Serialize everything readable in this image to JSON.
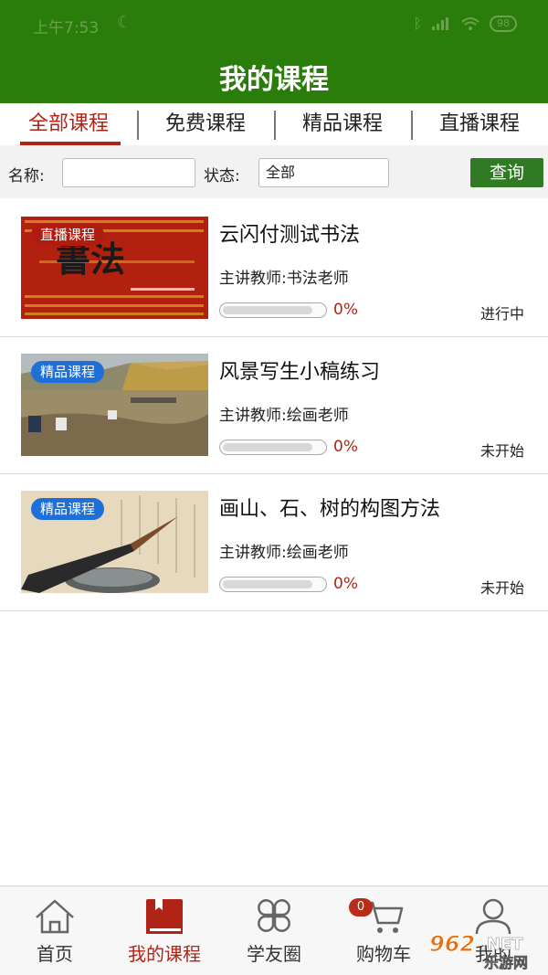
{
  "status_bar": {
    "time": "上午7:53",
    "battery": "98"
  },
  "header": {
    "title": "我的课程"
  },
  "tabs": [
    {
      "label": "全部课程",
      "active": true
    },
    {
      "label": "免费课程",
      "active": false
    },
    {
      "label": "精品课程",
      "active": false
    },
    {
      "label": "直播课程",
      "active": false
    }
  ],
  "filter": {
    "name_label": "名称:",
    "name_value": "",
    "status_label": "状态:",
    "status_value": "全部",
    "query_button": "查询"
  },
  "courses": [
    {
      "badge": "直播课程",
      "thumb_text": "書法",
      "title": "云闪付测试书法",
      "teacher": "主讲教师:书法老师",
      "progress": 0,
      "progress_text": "0%",
      "status": "进行中"
    },
    {
      "badge": "精品课程",
      "title": "风景写生小稿练习",
      "teacher": "主讲教师:绘画老师",
      "progress": 0,
      "progress_text": "0%",
      "status": "未开始"
    },
    {
      "badge": "精品课程",
      "title": "画山、石、树的构图方法",
      "teacher": "主讲教师:绘画老师",
      "progress": 0,
      "progress_text": "0%",
      "status": "未开始"
    }
  ],
  "bottom_nav": [
    {
      "label": "首页",
      "icon": "home-icon"
    },
    {
      "label": "我的课程",
      "icon": "book-icon",
      "active": true
    },
    {
      "label": "学友圈",
      "icon": "clover-icon"
    },
    {
      "label": "购物车",
      "icon": "cart-icon",
      "badge": "0"
    },
    {
      "label": "我的",
      "icon": "user-icon"
    }
  ],
  "watermark": {
    "text_top": "962",
    "text_suffix": ".NET",
    "text_bottom": "乐游网"
  },
  "colors": {
    "header": "#2a7d0a",
    "accent": "#b02418",
    "query_button": "#2f7a22",
    "badge_live": "#b01d10",
    "badge_premium": "#1e6fd8"
  }
}
